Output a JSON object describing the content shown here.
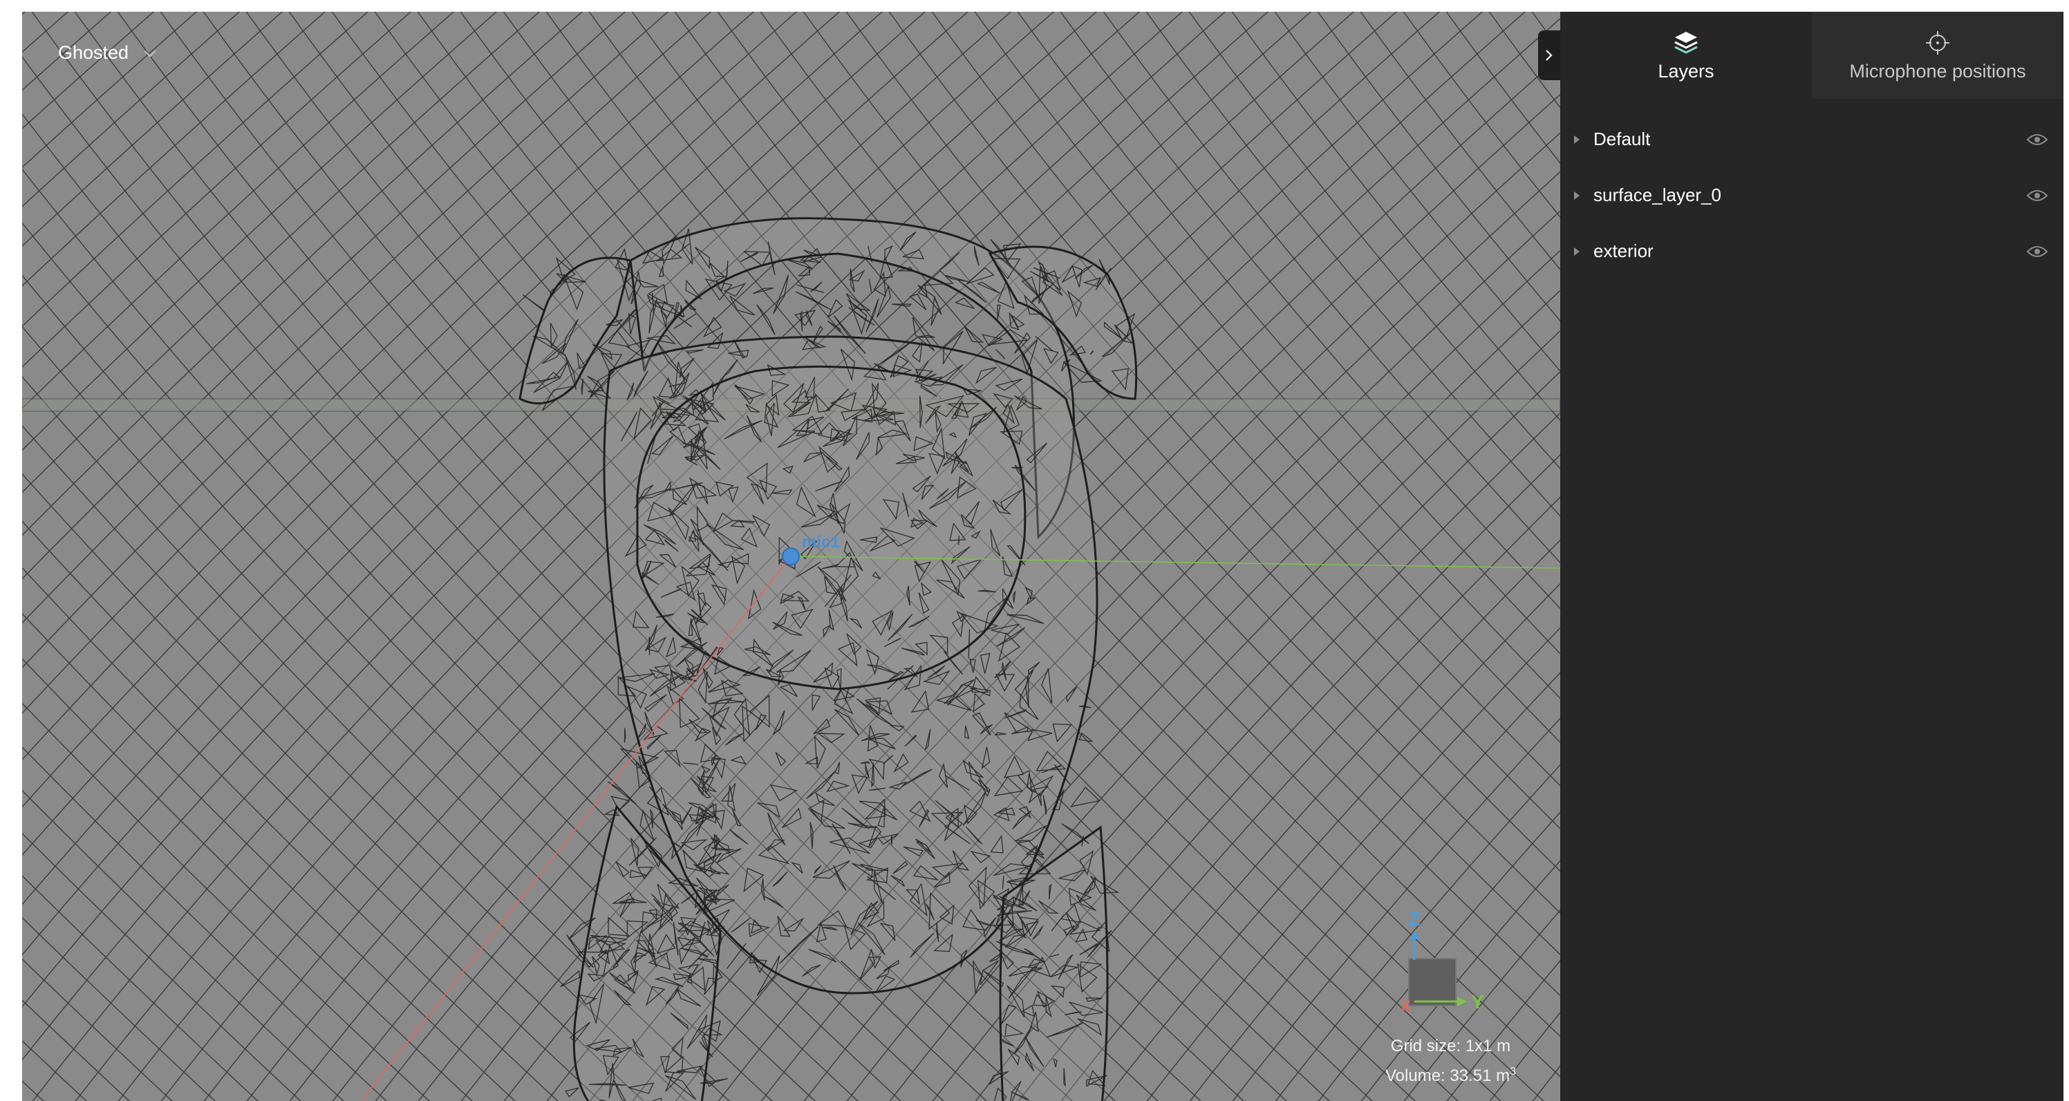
{
  "viewport": {
    "view_mode": "Ghosted",
    "grid_size_text": "Grid size: 1x1 m",
    "volume_text": "Volume: 33.51 m",
    "volume_unit_sup": "3",
    "mic_label": "mic1",
    "axis_labels": {
      "x": "X",
      "y": "Y",
      "z": "Z"
    },
    "colors": {
      "background": "#8a8a8a",
      "grid_line": "#3c3c3c",
      "wireframe": "#1e1e1e",
      "mic": "#4a8fd6",
      "x_axis": "#e06a5a",
      "y_axis": "#7fc24a",
      "z_axis": "#4a9de0"
    }
  },
  "panel": {
    "tabs": [
      {
        "label": "Layers",
        "icon": "layers-icon",
        "active": true
      },
      {
        "label": "Microphone positions",
        "icon": "crosshair-icon",
        "active": false
      }
    ],
    "layers": [
      {
        "name": "Default",
        "visible": true
      },
      {
        "name": "surface_layer_0",
        "visible": true
      },
      {
        "name": "exterior",
        "visible": true
      }
    ],
    "colors": {
      "background": "#262626",
      "text": "#ffffff",
      "muted": "#8c8c8c"
    }
  }
}
